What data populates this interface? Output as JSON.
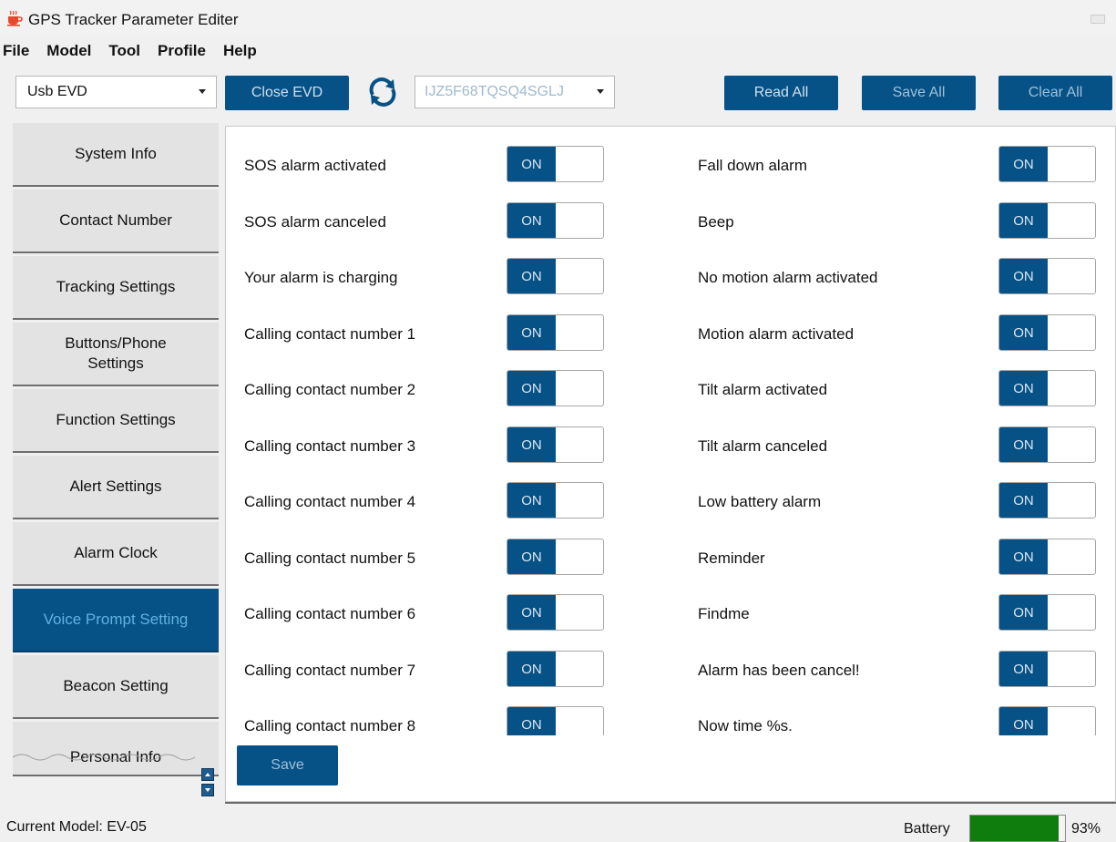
{
  "window": {
    "title": "GPS Tracker Parameter Editer",
    "app_icon": "cup-icon"
  },
  "menu": [
    "File",
    "Model",
    "Tool",
    "Profile",
    "Help"
  ],
  "toolbar": {
    "connection_select": "Usb EVD",
    "close_button": "Close EVD",
    "refresh_icon": "refresh-icon",
    "device_select": "IJZ5F68TQSQ4SGLJ",
    "read_all": "Read All",
    "save_all": "Save All",
    "clear_all": "Clear All"
  },
  "sidebar": {
    "items": [
      {
        "label": "System Info"
      },
      {
        "label": "Contact Number"
      },
      {
        "label": "Tracking Settings"
      },
      {
        "label": "Buttons/Phone\nSettings"
      },
      {
        "label": "Function Settings"
      },
      {
        "label": "Alert Settings"
      },
      {
        "label": "Alarm Clock"
      },
      {
        "label": "Voice Prompt Setting",
        "active": true
      },
      {
        "label": "Beacon Setting"
      },
      {
        "label": "Personal Info"
      }
    ]
  },
  "prompts": {
    "left": [
      {
        "label": "SOS alarm activated",
        "state": "ON"
      },
      {
        "label": "SOS alarm canceled",
        "state": "ON"
      },
      {
        "label": "Your alarm is charging",
        "state": "ON"
      },
      {
        "label": "Calling contact number 1",
        "state": "ON"
      },
      {
        "label": "Calling contact number 2",
        "state": "ON"
      },
      {
        "label": "Calling contact number 3",
        "state": "ON"
      },
      {
        "label": "Calling contact number 4",
        "state": "ON"
      },
      {
        "label": "Calling contact number 5",
        "state": "ON"
      },
      {
        "label": "Calling contact number 6",
        "state": "ON"
      },
      {
        "label": "Calling contact number 7",
        "state": "ON"
      },
      {
        "label": "Calling contact number 8",
        "state": "ON"
      }
    ],
    "right": [
      {
        "label": "Fall down alarm",
        "state": "ON"
      },
      {
        "label": "Beep",
        "state": "ON"
      },
      {
        "label": "No motion alarm activated",
        "state": "ON"
      },
      {
        "label": "Motion alarm activated",
        "state": "ON"
      },
      {
        "label": "Tilt alarm activated",
        "state": "ON"
      },
      {
        "label": "Tilt alarm canceled",
        "state": "ON"
      },
      {
        "label": "Low battery alarm",
        "state": "ON"
      },
      {
        "label": "Reminder",
        "state": "ON"
      },
      {
        "label": "Findme",
        "state": "ON"
      },
      {
        "label": "Alarm has been cancel!",
        "state": "ON"
      },
      {
        "label": "Now time %s.",
        "state": "ON"
      }
    ]
  },
  "save_button": "Save",
  "status": {
    "current_model": "Current Model: EV-05",
    "battery_label": "Battery",
    "battery_percent": "93%",
    "battery_level": 0.93
  },
  "colors": {
    "accent": "#065186",
    "active_nav_text": "#5fb2e2",
    "battery": "#0e7d0e"
  }
}
